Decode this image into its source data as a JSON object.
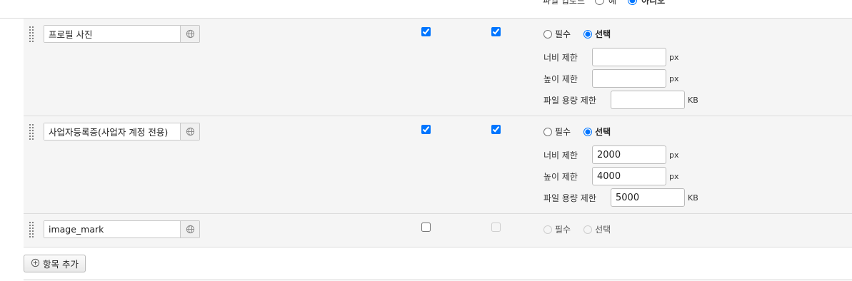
{
  "top": {
    "upload_label": "파일 업로드",
    "yes": "예",
    "no": "아니오"
  },
  "rows": [
    {
      "name": "프로필 사진",
      "required": "필수",
      "optional": "선택",
      "width_label": "너비 제한",
      "width_value": "",
      "width_unit": "px",
      "height_label": "높이 제한",
      "height_value": "",
      "height_unit": "px",
      "size_label": "파일 용량 제한",
      "size_value": "",
      "size_unit": "KB"
    },
    {
      "name": "사업자등록증(사업자 계정 전용)",
      "required": "필수",
      "optional": "선택",
      "width_label": "너비 제한",
      "width_value": "2000",
      "width_unit": "px",
      "height_label": "높이 제한",
      "height_value": "4000",
      "height_unit": "px",
      "size_label": "파일 용량 제한",
      "size_value": "5000",
      "size_unit": "KB"
    },
    {
      "name": "image_mark",
      "required": "필수",
      "optional": "선택"
    }
  ],
  "add_button": "항목 추가",
  "icons": {
    "globe": "globe-icon",
    "plus": "plus-circle-icon",
    "drag": "drag-handle-icon"
  }
}
